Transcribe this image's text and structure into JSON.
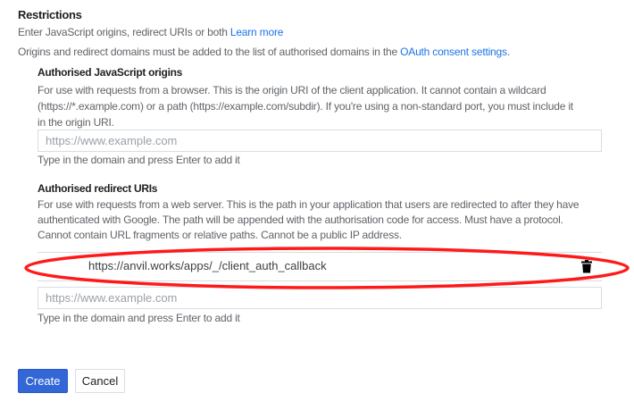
{
  "restrictions": {
    "title": "Restrictions",
    "intro": "Enter JavaScript origins, redirect URIs or both",
    "learn_more": "Learn more",
    "domains_note": "Origins and redirect domains must be added to the list of authorised domains in the",
    "oauth_link": "OAuth consent settings",
    "period": "."
  },
  "js_origins": {
    "title": "Authorised JavaScript origins",
    "desc": [
      "For use with requests from a browser. This is the origin URI of the client application. It cannot contain a wildcard",
      "(https://*.example.com) or a path (https://example.com/subdir). If you're using a non-standard port, you must include it",
      "in the origin URI."
    ],
    "placeholder": "https://www.example.com",
    "hint": "Type in the domain and press Enter to add it"
  },
  "redirect_uris": {
    "title": "Authorised redirect URIs",
    "desc": [
      "For use with requests from a web server. This is the path in your application that users are redirected to after they have",
      "authenticated with Google. The path will be appended with the authorisation code for access. Must have a protocol.",
      "Cannot contain URL fragments or relative paths. Cannot be a public IP address."
    ],
    "uris": [
      "https://anvil.works/apps/_/client_auth_callback"
    ],
    "delete_icon": "trash-icon",
    "placeholder": "https://www.example.com",
    "hint": "Type in the domain and press Enter to add it"
  },
  "actions": {
    "create": "Create",
    "cancel": "Cancel"
  },
  "colors": {
    "accent": "#3367d6",
    "annotation": "#ff1a1a"
  }
}
